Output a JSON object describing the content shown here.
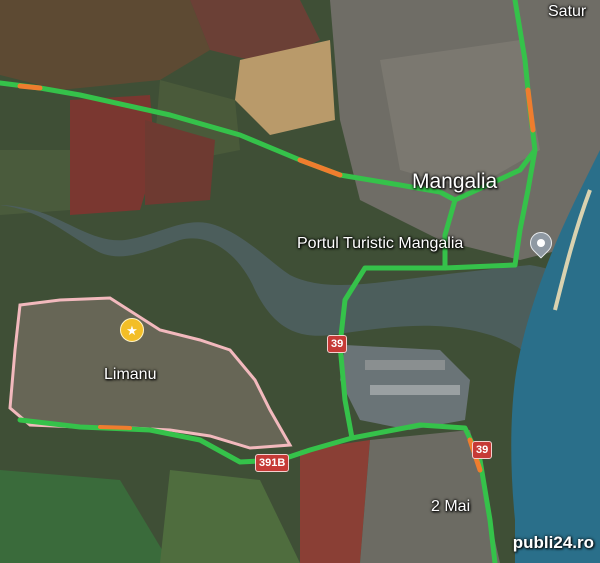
{
  "map": {
    "labels": {
      "saturn": "Satur",
      "mangalia": "Mangalia",
      "port": "Portul Turistic Mangalia",
      "limanu": "Limanu",
      "two_mai": "2 Mai"
    },
    "road_shields": {
      "r39_north": "39",
      "r39_south": "39",
      "r391b": "391B"
    },
    "markers": {
      "limanu_icon": "star-pin-icon",
      "port_icon": "location-pin-icon"
    },
    "colors": {
      "traffic_green": "#35c24a",
      "traffic_orange": "#ef7d2e",
      "boundary": "#f2b9bd",
      "water": "#2f4b52",
      "sea": "#2a6f8a"
    }
  },
  "watermark": "publi24.ro"
}
